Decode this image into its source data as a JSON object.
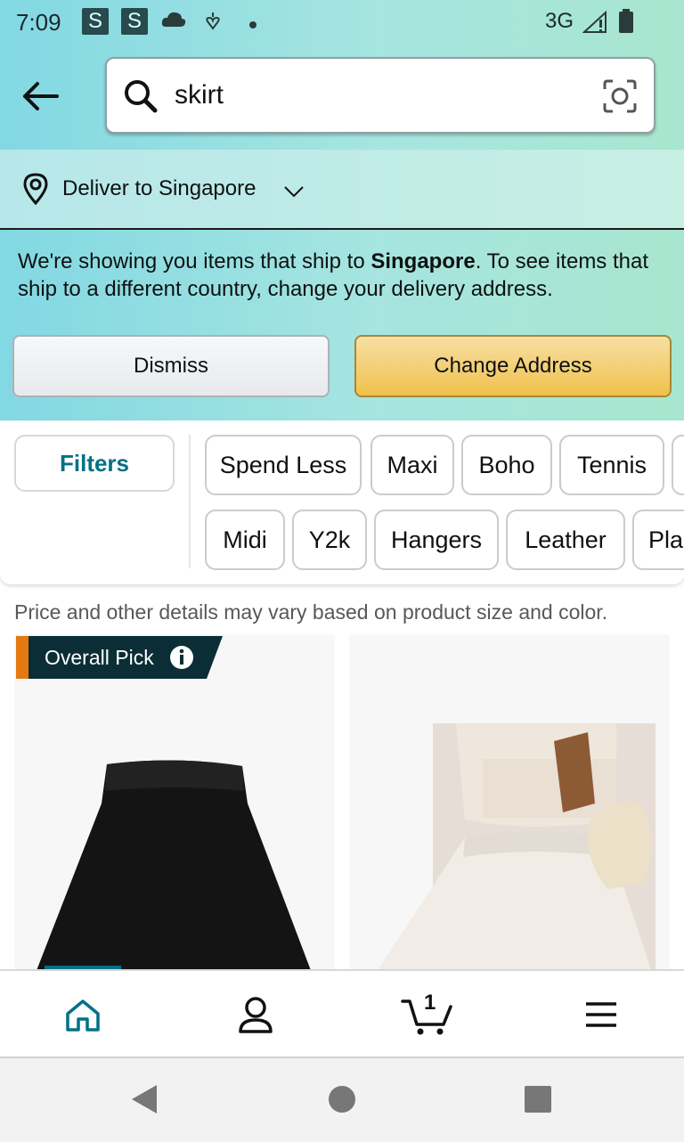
{
  "status_bar": {
    "time": "7:09",
    "badge1": "S",
    "badge2": "S",
    "network": "3G"
  },
  "search": {
    "query": "skirt",
    "back_icon": "arrow-left-icon",
    "camera_icon": "camera-lens-icon"
  },
  "delivery": {
    "label": "Deliver to Singapore"
  },
  "notice": {
    "part1": "We're showing you items that ship to ",
    "country": "Singapore",
    "part2": ". To see items that ship to a different country, change your delivery address."
  },
  "buttons": {
    "dismiss": "Dismiss",
    "change_address": "Change Address"
  },
  "filters": {
    "label": "Filters",
    "row1": [
      "Spend Less",
      "Maxi",
      "Boho",
      "Tennis"
    ],
    "row2": [
      "Midi",
      "Y2k",
      "Hangers",
      "Leather",
      "Pla"
    ]
  },
  "results": {
    "price_note": "Price and other details may vary based on product size and color.",
    "badge": "Overall Pick"
  },
  "bottom_nav": {
    "cart_count": "1"
  },
  "colors": {
    "accent": "#007185",
    "header_start": "#82d8e3",
    "header_end": "#a8e6cf",
    "change_button": "#f0c14b",
    "badge_bg": "#0b2e36",
    "badge_stripe": "#e47911"
  }
}
